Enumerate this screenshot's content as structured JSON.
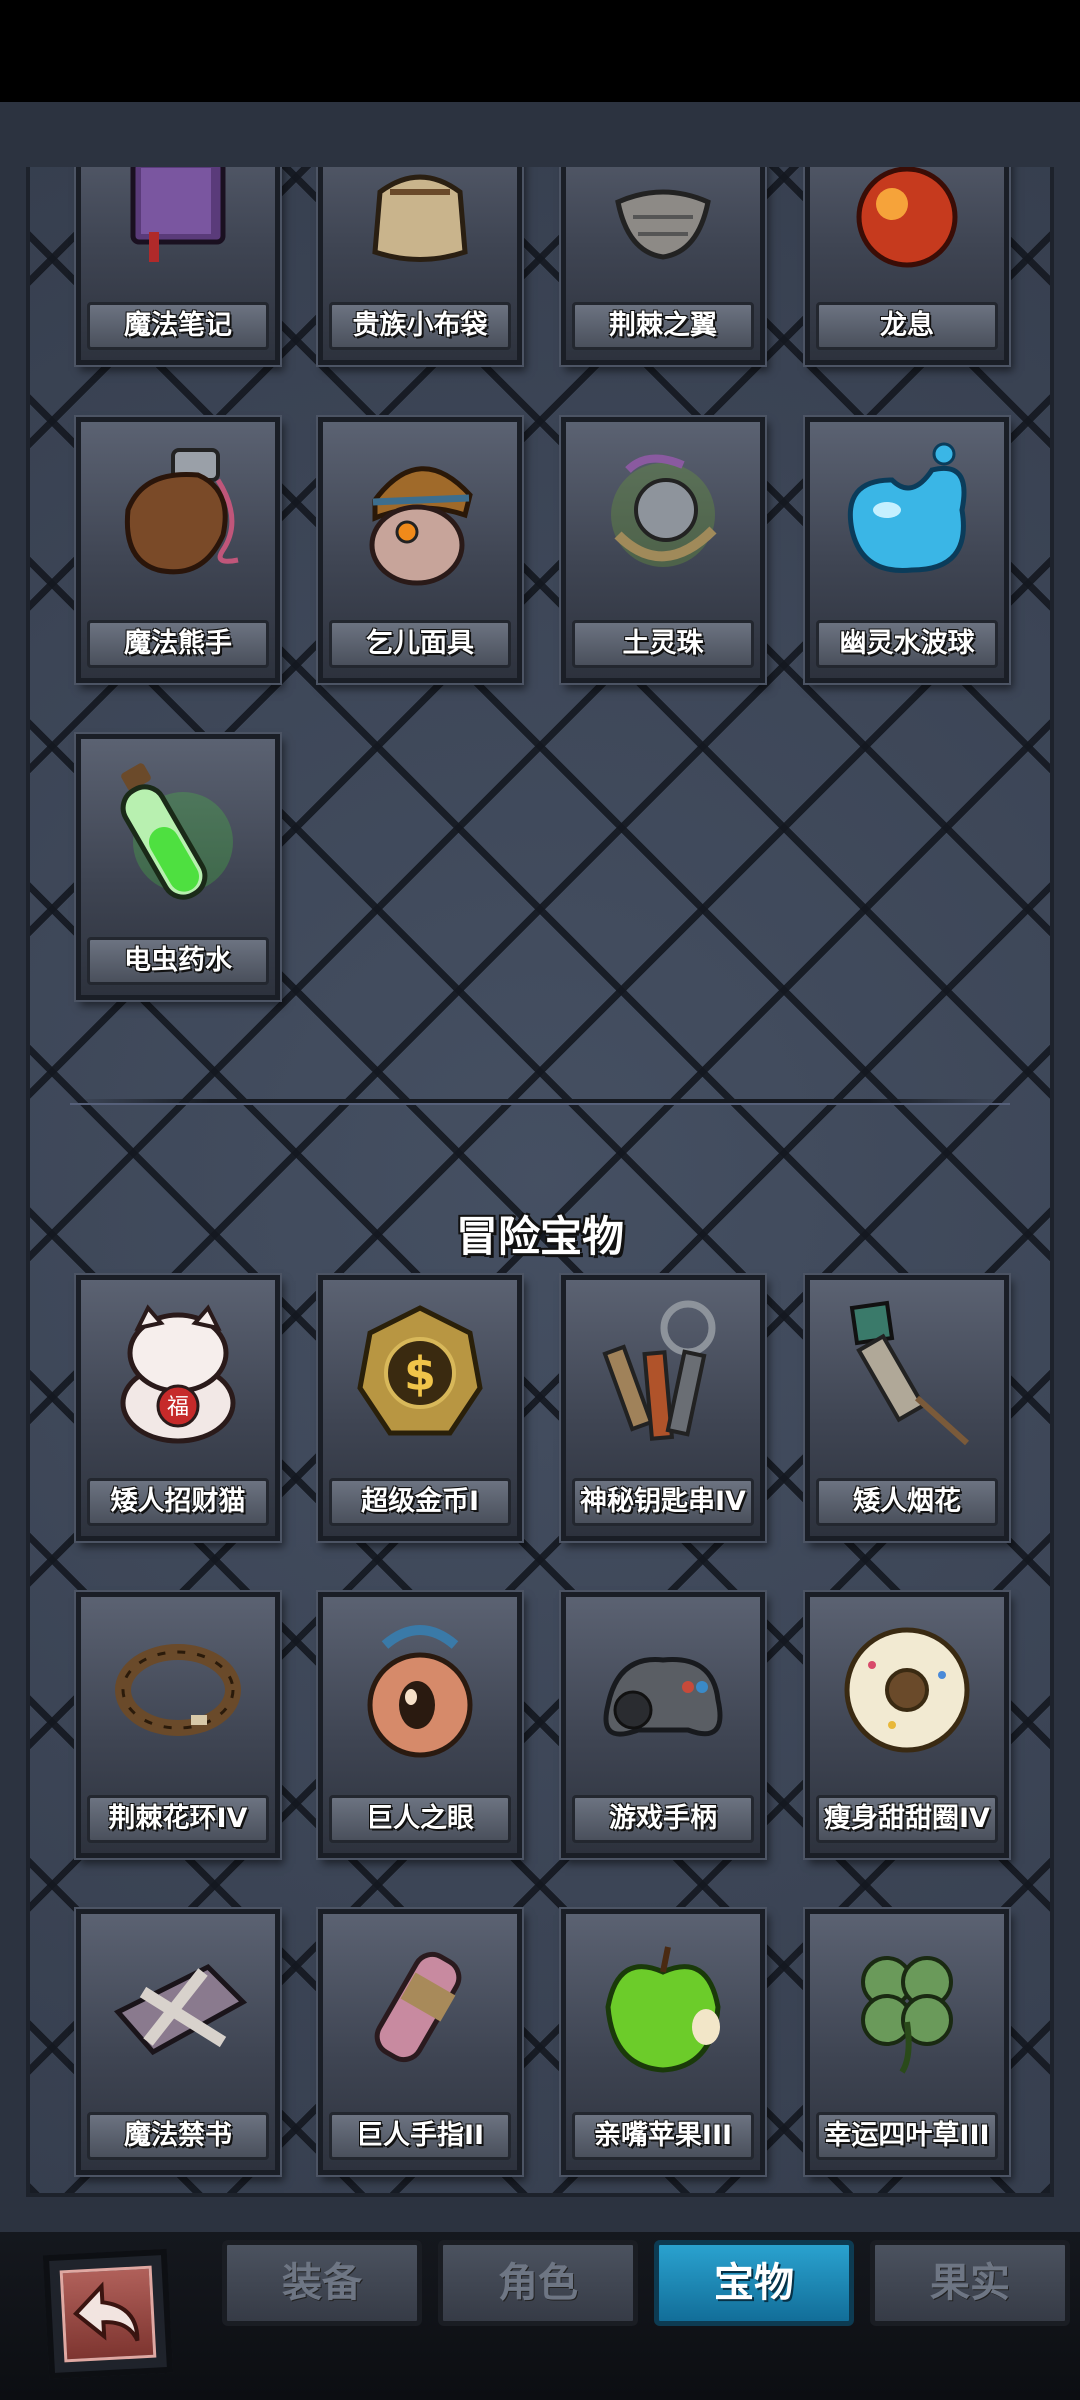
{
  "magic_items": [
    {
      "name": "魔法笔记",
      "icon": "book-icon"
    },
    {
      "name": "贵族小布袋",
      "icon": "pouch-icon"
    },
    {
      "name": "荆棘之翼",
      "icon": "wing-icon"
    },
    {
      "name": "龙息",
      "icon": "fire-orb-icon"
    },
    {
      "name": "魔法熊手",
      "icon": "bear-paw-icon"
    },
    {
      "name": "乞儿面具",
      "icon": "beggar-mask-icon"
    },
    {
      "name": "土灵珠",
      "icon": "earth-orb-icon"
    },
    {
      "name": "幽灵水波球",
      "icon": "water-blob-icon"
    },
    {
      "name": "电虫药水",
      "icon": "potion-icon"
    }
  ],
  "adventure_section": {
    "title": "冒险宝物",
    "items": [
      {
        "name": "矮人招财猫",
        "icon": "lucky-cat-icon"
      },
      {
        "name": "超级金币I",
        "icon": "gold-coin-icon"
      },
      {
        "name": "神秘钥匙串IV",
        "icon": "keys-icon"
      },
      {
        "name": "矮人烟花",
        "icon": "firework-icon"
      },
      {
        "name": "荆棘花环IV",
        "icon": "thorn-wreath-icon"
      },
      {
        "name": "巨人之眼",
        "icon": "giant-eye-icon"
      },
      {
        "name": "游戏手柄",
        "icon": "gamepad-icon"
      },
      {
        "name": "瘦身甜甜圈IV",
        "icon": "donut-icon"
      },
      {
        "name": "魔法禁书",
        "icon": "forbidden-book-icon"
      },
      {
        "name": "巨人手指II",
        "icon": "giant-finger-icon"
      },
      {
        "name": "亲嘴苹果III",
        "icon": "apple-icon"
      },
      {
        "name": "幸运四叶草III",
        "icon": "clover-icon"
      }
    ]
  },
  "bottom_nav": {
    "back_icon": "back-arrow-icon",
    "tabs": [
      "装备",
      "角色",
      "宝物",
      "果实"
    ],
    "active_tab": "宝物"
  },
  "colors": {
    "panel_bg": "#3a4354",
    "active_tab": "#1f8fbe",
    "back_button": "#9c4a44"
  }
}
